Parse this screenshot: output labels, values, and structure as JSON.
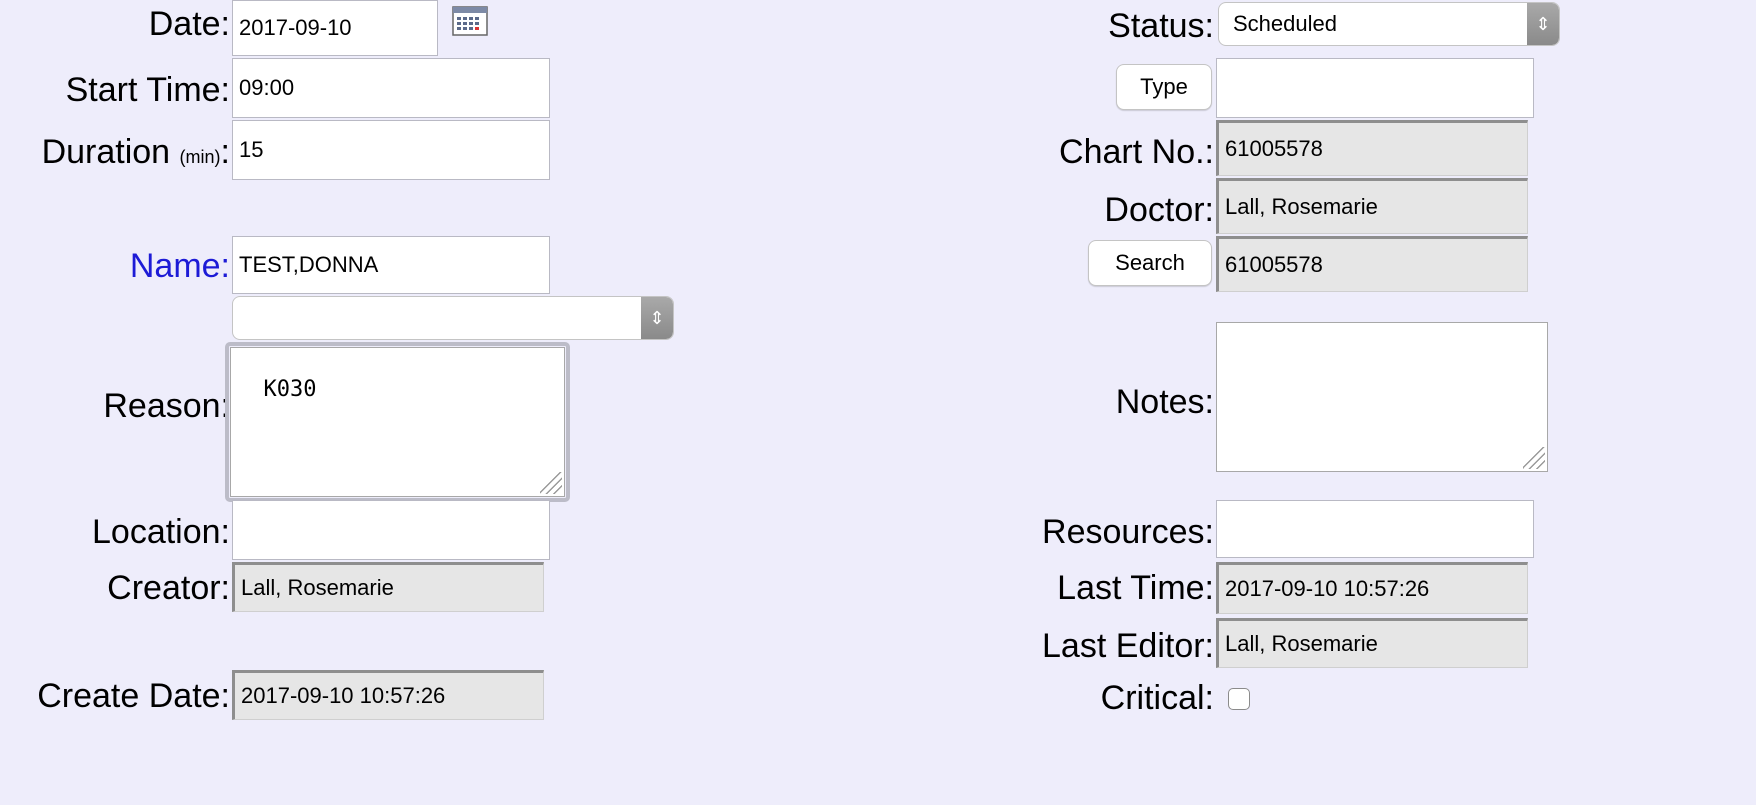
{
  "left": {
    "date": {
      "label": "Date:",
      "value": "2017-09-10"
    },
    "start_time": {
      "label": "Start Time:",
      "value": "09:00"
    },
    "duration": {
      "label": "Duration",
      "unit": "(min)",
      "colon": ":",
      "value": "15"
    },
    "name": {
      "label": "Name:",
      "value": "TEST,DONNA"
    },
    "name_select": {
      "value": ""
    },
    "reason": {
      "label": "Reason:",
      "value": "K030"
    },
    "location": {
      "label": "Location:",
      "value": ""
    },
    "creator": {
      "label": "Creator:",
      "value": "Lall, Rosemarie"
    },
    "create_date": {
      "label": "Create Date:",
      "value": "2017-09-10 10:57:26"
    }
  },
  "right": {
    "status": {
      "label": "Status:",
      "value": "Scheduled"
    },
    "type": {
      "button_label": "Type",
      "value": ""
    },
    "chart_no": {
      "label": "Chart No.:",
      "value": "61005578"
    },
    "doctor": {
      "label": "Doctor:",
      "value": "Lall, Rosemarie"
    },
    "search": {
      "button_label": "Search",
      "value": "61005578"
    },
    "notes": {
      "label": "Notes:",
      "value": ""
    },
    "resources": {
      "label": "Resources:",
      "value": ""
    },
    "last_time": {
      "label": "Last Time:",
      "value": "2017-09-10 10:57:26"
    },
    "last_editor": {
      "label": "Last Editor:",
      "value": "Lall, Rosemarie"
    },
    "critical": {
      "label": "Critical:",
      "checked": false
    }
  },
  "icons": {
    "calendar": "calendar-icon",
    "select_arrows": "updown-chevron-icon",
    "resize": "resize-grip-icon"
  }
}
